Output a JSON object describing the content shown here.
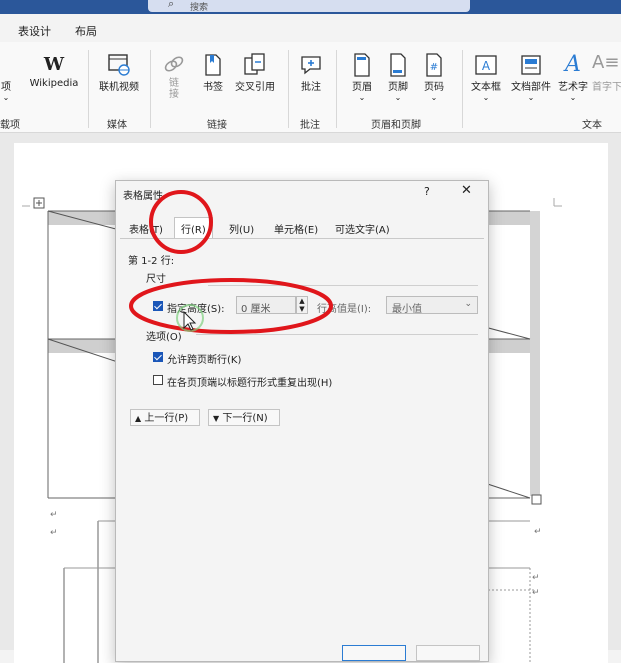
{
  "app": {
    "search_placeholder": "搜索"
  },
  "ribbon_tabs": [
    "表设计",
    "布局"
  ],
  "ribbon": {
    "buttons": [
      {
        "label": "项",
        "icon": "partial-icon"
      },
      {
        "label": "Wikipedia",
        "icon": "wikipedia-icon"
      },
      {
        "label": "联机视频",
        "icon": "online-video-icon"
      },
      {
        "label": "链接",
        "icon": "link-icon"
      },
      {
        "label": "书签",
        "icon": "bookmark-icon"
      },
      {
        "label": "交叉引用",
        "icon": "cross-reference-icon"
      },
      {
        "label": "批注",
        "icon": "comment-icon"
      },
      {
        "label": "页眉",
        "icon": "header-icon"
      },
      {
        "label": "页脚",
        "icon": "footer-icon"
      },
      {
        "label": "页码",
        "icon": "page-number-icon"
      },
      {
        "label": "文本框",
        "icon": "text-box-icon"
      },
      {
        "label": "文档部件",
        "icon": "quick-parts-icon"
      },
      {
        "label": "艺术字",
        "icon": "wordart-icon"
      },
      {
        "label": "首字下",
        "icon": "drop-cap-icon"
      }
    ],
    "groups": [
      "载项",
      "媒体",
      "链接",
      "批注",
      "页眉和页脚",
      "文本"
    ]
  },
  "dialog": {
    "title": "表格属性",
    "help": "?",
    "close": "✕",
    "tabs": [
      "表格(T)",
      "行(R)",
      "列(U)",
      "单元格(E)",
      "可选文字(A)"
    ],
    "active_tab": "行(R)",
    "row_header": "第 1-2 行:",
    "size_label": "尺寸",
    "specify_height_label": "指定高度(S):",
    "specify_height_checked": true,
    "height_value": "0 厘米",
    "row_height_is_label": "行高值是(I):",
    "row_height_is_value": "最小值",
    "options_label": "选项(O)",
    "allow_break_label": "允许跨页断行(K)",
    "allow_break_checked": true,
    "repeat_header_label": "在各页顶端以标题行形式重复出现(H)",
    "repeat_header_checked": false,
    "prev_row_label": "上一行(P)",
    "next_row_label": "下一行(N)"
  },
  "colors": {
    "accent": "#2b579a",
    "checkbox_on": "#1a56b8",
    "annotation_red": "#e0161b",
    "cursor_ring": "#7fd07f"
  }
}
